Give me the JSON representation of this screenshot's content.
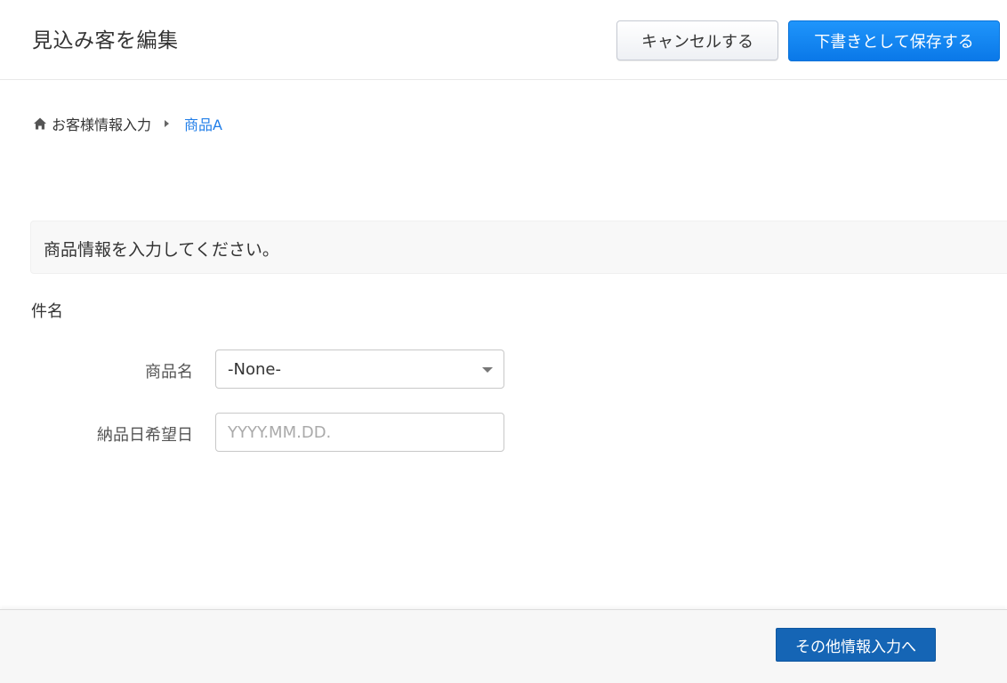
{
  "header": {
    "title": "見込み客を編集",
    "cancel_label": "キャンセルする",
    "save_draft_label": "下書きとして保存する"
  },
  "breadcrumb": {
    "home_icon": "home-icon",
    "home_label": "お客様情報入力",
    "separator_icon": "caret-right-icon",
    "current_label": "商品A"
  },
  "info": {
    "message": "商品情報を入力してください。"
  },
  "section": {
    "title": "件名"
  },
  "fields": {
    "product_name": {
      "label": "商品名",
      "value": "-None-"
    },
    "delivery_date": {
      "label": "納品日希望日",
      "value": "",
      "placeholder": "YYYY.MM.DD."
    }
  },
  "footer": {
    "next_label": "その他情報入力へ"
  },
  "colors": {
    "primary": "#0a78e8",
    "link": "#1f7de8",
    "footer_button": "#1565b5"
  }
}
